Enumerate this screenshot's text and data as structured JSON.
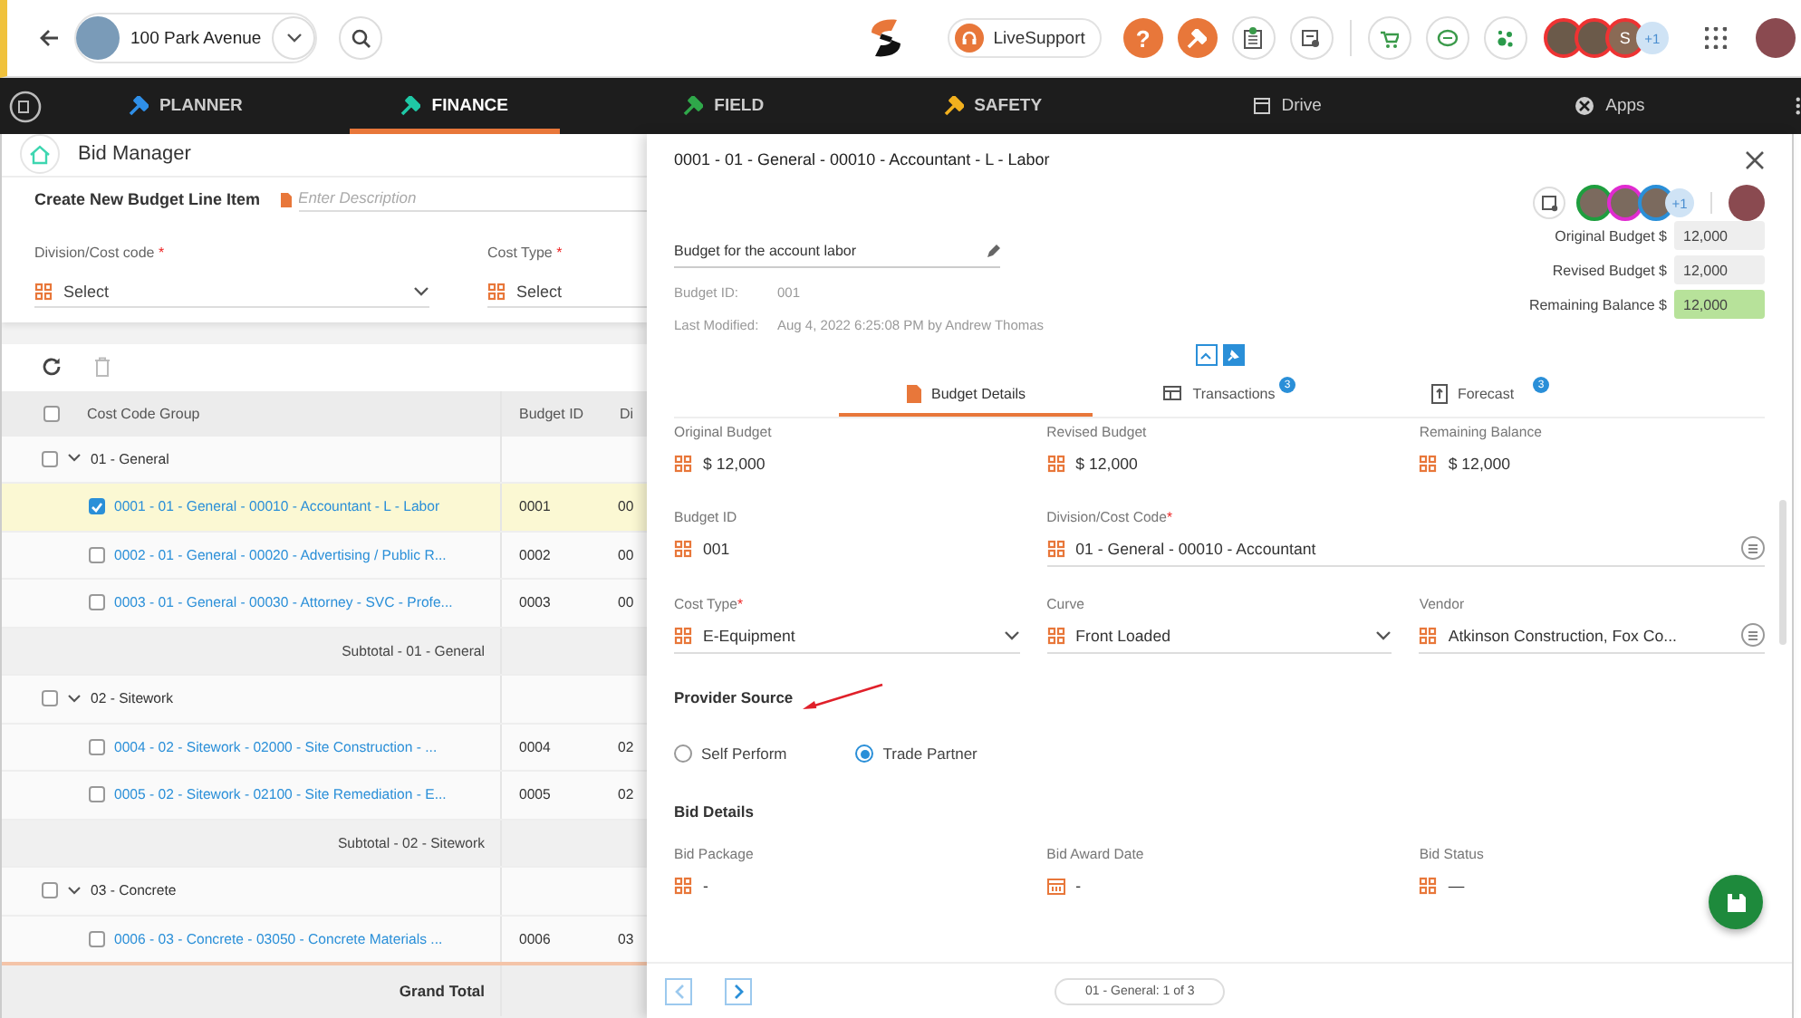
{
  "top_bar": {
    "project": {
      "name": "100 Park Avenue"
    },
    "live_support": {
      "label": "LiveSupport"
    },
    "help": {
      "label": "?"
    },
    "collaborators": [
      {
        "kind": "photo"
      },
      {
        "kind": "photo"
      },
      {
        "kind": "initial",
        "initial": "S"
      }
    ],
    "more_collaborators": "+1"
  },
  "nav": {
    "items": [
      {
        "kind": "module",
        "label": "PLANNER",
        "color": "#2f8fe8",
        "selected": false
      },
      {
        "kind": "module",
        "label": "FINANCE",
        "color": "#1fc9a6",
        "selected": true
      },
      {
        "kind": "module",
        "label": "FIELD",
        "color": "#2fa84a",
        "selected": false
      },
      {
        "kind": "module",
        "label": "SAFETY",
        "color": "#f2b01e",
        "selected": false
      },
      {
        "kind": "drive",
        "label": "Drive",
        "selected": false
      },
      {
        "kind": "apps",
        "label": "Apps",
        "selected": false
      }
    ]
  },
  "bid_manager": {
    "title": "Bid Manager",
    "create": {
      "title": "Create New Budget Line Item",
      "placeholder": "Enter Description",
      "fields": [
        {
          "label": "Division/Cost code",
          "required_mark": "*",
          "value": "Select"
        },
        {
          "label": "Cost Type",
          "required_mark": "*",
          "value": "Select"
        }
      ]
    },
    "table": {
      "columns": [
        "Cost Code Group",
        "Budget ID",
        "Di"
      ],
      "select_all_checked": false,
      "rows": [
        {
          "kind": "group",
          "label": "01 - General",
          "checked": false,
          "expanded": true
        },
        {
          "kind": "item",
          "label": "0001 - 01 - General - 00010 - Accountant - L - Labor",
          "budget_id": "0001",
          "column_3": "00",
          "checked": true,
          "selected": true
        },
        {
          "kind": "item",
          "label": "0002 - 01 - General - 00020 - Advertising / Public R...",
          "budget_id": "0002",
          "column_3": "00",
          "checked": false,
          "selected": false
        },
        {
          "kind": "item",
          "label": "0003 - 01 - General - 00030 - Attorney - SVC - Profe...",
          "budget_id": "0003",
          "column_3": "00",
          "checked": false,
          "selected": false
        },
        {
          "kind": "subtotal",
          "label": "Subtotal - 01 - General"
        },
        {
          "kind": "group",
          "label": "02 - Sitework",
          "checked": false,
          "expanded": true
        },
        {
          "kind": "item",
          "label": "0004 - 02 - Sitework - 02000 - Site Construction - ...",
          "budget_id": "0004",
          "column_3": "02",
          "checked": false,
          "selected": false
        },
        {
          "kind": "item",
          "label": "0005 - 02 - Sitework - 02100 - Site Remediation - E...",
          "budget_id": "0005",
          "column_3": "02",
          "checked": false,
          "selected": false
        },
        {
          "kind": "subtotal",
          "label": "Subtotal - 02 - Sitework"
        },
        {
          "kind": "group",
          "label": "03 - Concrete",
          "checked": false,
          "expanded": true
        },
        {
          "kind": "item",
          "label": "0006 - 03 - Concrete - 03050 - Concrete Materials ...",
          "budget_id": "0006",
          "column_3": "03",
          "checked": false,
          "selected": false
        }
      ],
      "grand_total": "Grand Total"
    }
  },
  "detail": {
    "title": "0001 - 01 - General - 00010 - Accountant - L - Labor",
    "watchers": [
      {
        "color": "#1e9e3e"
      },
      {
        "color": "#e02bd0"
      },
      {
        "color": "#2a8fd8"
      }
    ],
    "more_watchers": "+1",
    "description": "Budget for the account labor",
    "meta": [
      {
        "label": "Budget ID:",
        "value": "001"
      },
      {
        "label": "Last Modified:",
        "value": "Aug 4, 2022 6:25:08 PM by Andrew Thomas"
      }
    ],
    "summary": [
      {
        "label": "Original Budget $",
        "value": "12,000",
        "highlight": false
      },
      {
        "label": "Revised Budget $",
        "value": "12,000",
        "highlight": false
      },
      {
        "label": "Remaining Balance $",
        "value": "12,000",
        "highlight": true
      }
    ],
    "tabs": [
      {
        "kind": "details",
        "label": "Budget Details",
        "selected": true
      },
      {
        "kind": "transactions",
        "label": "Transactions",
        "badge": "3",
        "selected": false
      },
      {
        "kind": "forecast",
        "label": "Forecast",
        "badge": "3",
        "selected": false
      }
    ],
    "rows": [
      [
        {
          "kind": "text",
          "label": "Original Budget",
          "value": "$ 12,000"
        },
        {
          "kind": "text",
          "label": "Revised Budget",
          "value": "$ 12,000"
        },
        {
          "kind": "text",
          "label": "Remaining Balance",
          "value": "$ 12,000"
        }
      ],
      [
        {
          "kind": "text",
          "label": "Budget ID",
          "value": "001"
        },
        {
          "kind": "lookup",
          "label": "Division/Cost Code",
          "required_mark": "*",
          "value": "01 - General - 00010 - Accountant"
        }
      ],
      [
        {
          "kind": "select",
          "label": "Cost Type",
          "required_mark": "*",
          "value": "E-Equipment"
        },
        {
          "kind": "select",
          "label": "Curve",
          "value": "Front Loaded"
        },
        {
          "kind": "lookup",
          "label": "Vendor",
          "value": "Atkinson Construction, Fox Co..."
        }
      ]
    ],
    "provider_source": {
      "title": "Provider Source",
      "options": [
        {
          "label": "Self Perform",
          "selected": false
        },
        {
          "label": "Trade Partner",
          "selected": true
        }
      ]
    },
    "bid_details": {
      "title": "Bid Details",
      "fields": [
        {
          "kind": "text",
          "label": "Bid Package",
          "value": "-"
        },
        {
          "kind": "date",
          "label": "Bid Award Date",
          "value": "-"
        },
        {
          "kind": "text",
          "label": "Bid Status",
          "value": "—"
        }
      ]
    },
    "pager": "01 - General: 1 of 3"
  }
}
